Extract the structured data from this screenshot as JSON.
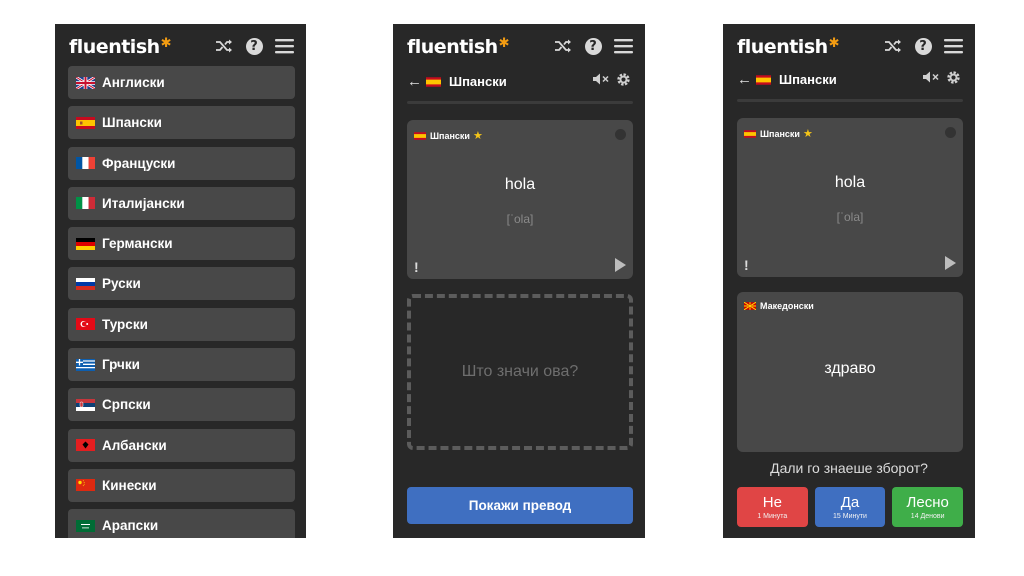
{
  "app": {
    "logo": "fluentish",
    "logo_mark": "✱"
  },
  "languages": [
    {
      "label": "Англиски",
      "flag": "uk"
    },
    {
      "label": "Шпански",
      "flag": "es"
    },
    {
      "label": "Француски",
      "flag": "fr"
    },
    {
      "label": "Италијански",
      "flag": "it"
    },
    {
      "label": "Германски",
      "flag": "de"
    },
    {
      "label": "Руски",
      "flag": "ru"
    },
    {
      "label": "Турски",
      "flag": "tr"
    },
    {
      "label": "Грчки",
      "flag": "gr"
    },
    {
      "label": "Српски",
      "flag": "rs"
    },
    {
      "label": "Албански",
      "flag": "al"
    },
    {
      "label": "Кинески",
      "flag": "cn"
    },
    {
      "label": "Арапски",
      "flag": "sa"
    }
  ],
  "deck": {
    "name": "Шпански",
    "flag": "es"
  },
  "front_card": {
    "lang": "Шпански",
    "star": "★",
    "word": "hola",
    "ipa": "[ˈola]",
    "flag_button": "!"
  },
  "back_card": {
    "lang": "Македонски",
    "translation": "здраво"
  },
  "prompt_placeholder": "Што значи ова?",
  "show_button": "Покажи превод",
  "question": "Дали го знаеше зборот?",
  "answers": [
    {
      "label": "Не",
      "interval": "1 Минута"
    },
    {
      "label": "Да",
      "interval": "15 Минути"
    },
    {
      "label": "Лесно",
      "interval": "14 Денови"
    }
  ],
  "colors": {
    "background": "#282828",
    "card": "#484848",
    "primary_blue": "#3f6fc1",
    "red": "#e04545",
    "green": "#3fae49",
    "star_yellow": "#f5c518",
    "logo_orange": "#f39c12"
  }
}
